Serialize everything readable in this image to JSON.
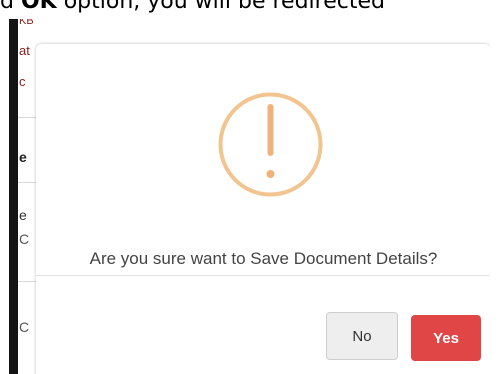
{
  "caption": {
    "text_prefix": "d ",
    "text_bold": "OK",
    "text_suffix": " option, you will be redirected"
  },
  "background": {
    "fragments": [
      "KB",
      "at",
      "c",
      "e",
      "e",
      "C",
      "C"
    ]
  },
  "dialog": {
    "icon": "warning-exclamation-icon",
    "message": "Are you sure want to Save Document Details?",
    "no_label": "No",
    "yes_label": "Yes",
    "colors": {
      "icon": "#f2c48f",
      "yes_button": "#e04646",
      "no_button": "#eeeeee"
    }
  }
}
